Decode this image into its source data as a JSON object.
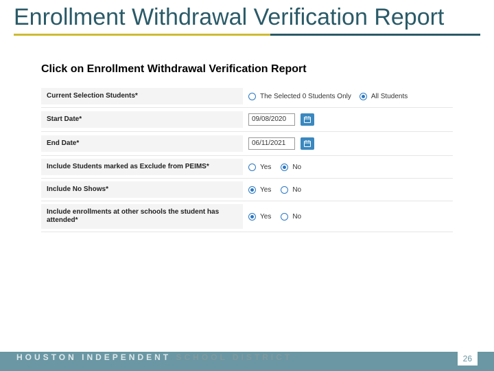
{
  "title": "Enrollment Withdrawal Verification Report",
  "instruction": "Click on Enrollment Withdrawal Verification Report",
  "rows": {
    "selection": {
      "label": "Current Selection Students*",
      "opt1": "The Selected 0 Students Only",
      "opt2": "All Students"
    },
    "start": {
      "label": "Start Date*",
      "value": "09/08/2020"
    },
    "end": {
      "label": "End Date*",
      "value": "06/11/2021"
    },
    "exclude": {
      "label": "Include Students marked as Exclude from PEIMS*",
      "yes": "Yes",
      "no": "No"
    },
    "noshow": {
      "label": "Include No Shows*",
      "yes": "Yes",
      "no": "No"
    },
    "other": {
      "label": "Include enrollments at other schools the student has attended*",
      "yes": "Yes",
      "no": "No"
    }
  },
  "footer": {
    "org_left": "HOUSTON INDEPENDENT",
    "org_right": "SCHOOL DISTRICT",
    "page": "26"
  }
}
